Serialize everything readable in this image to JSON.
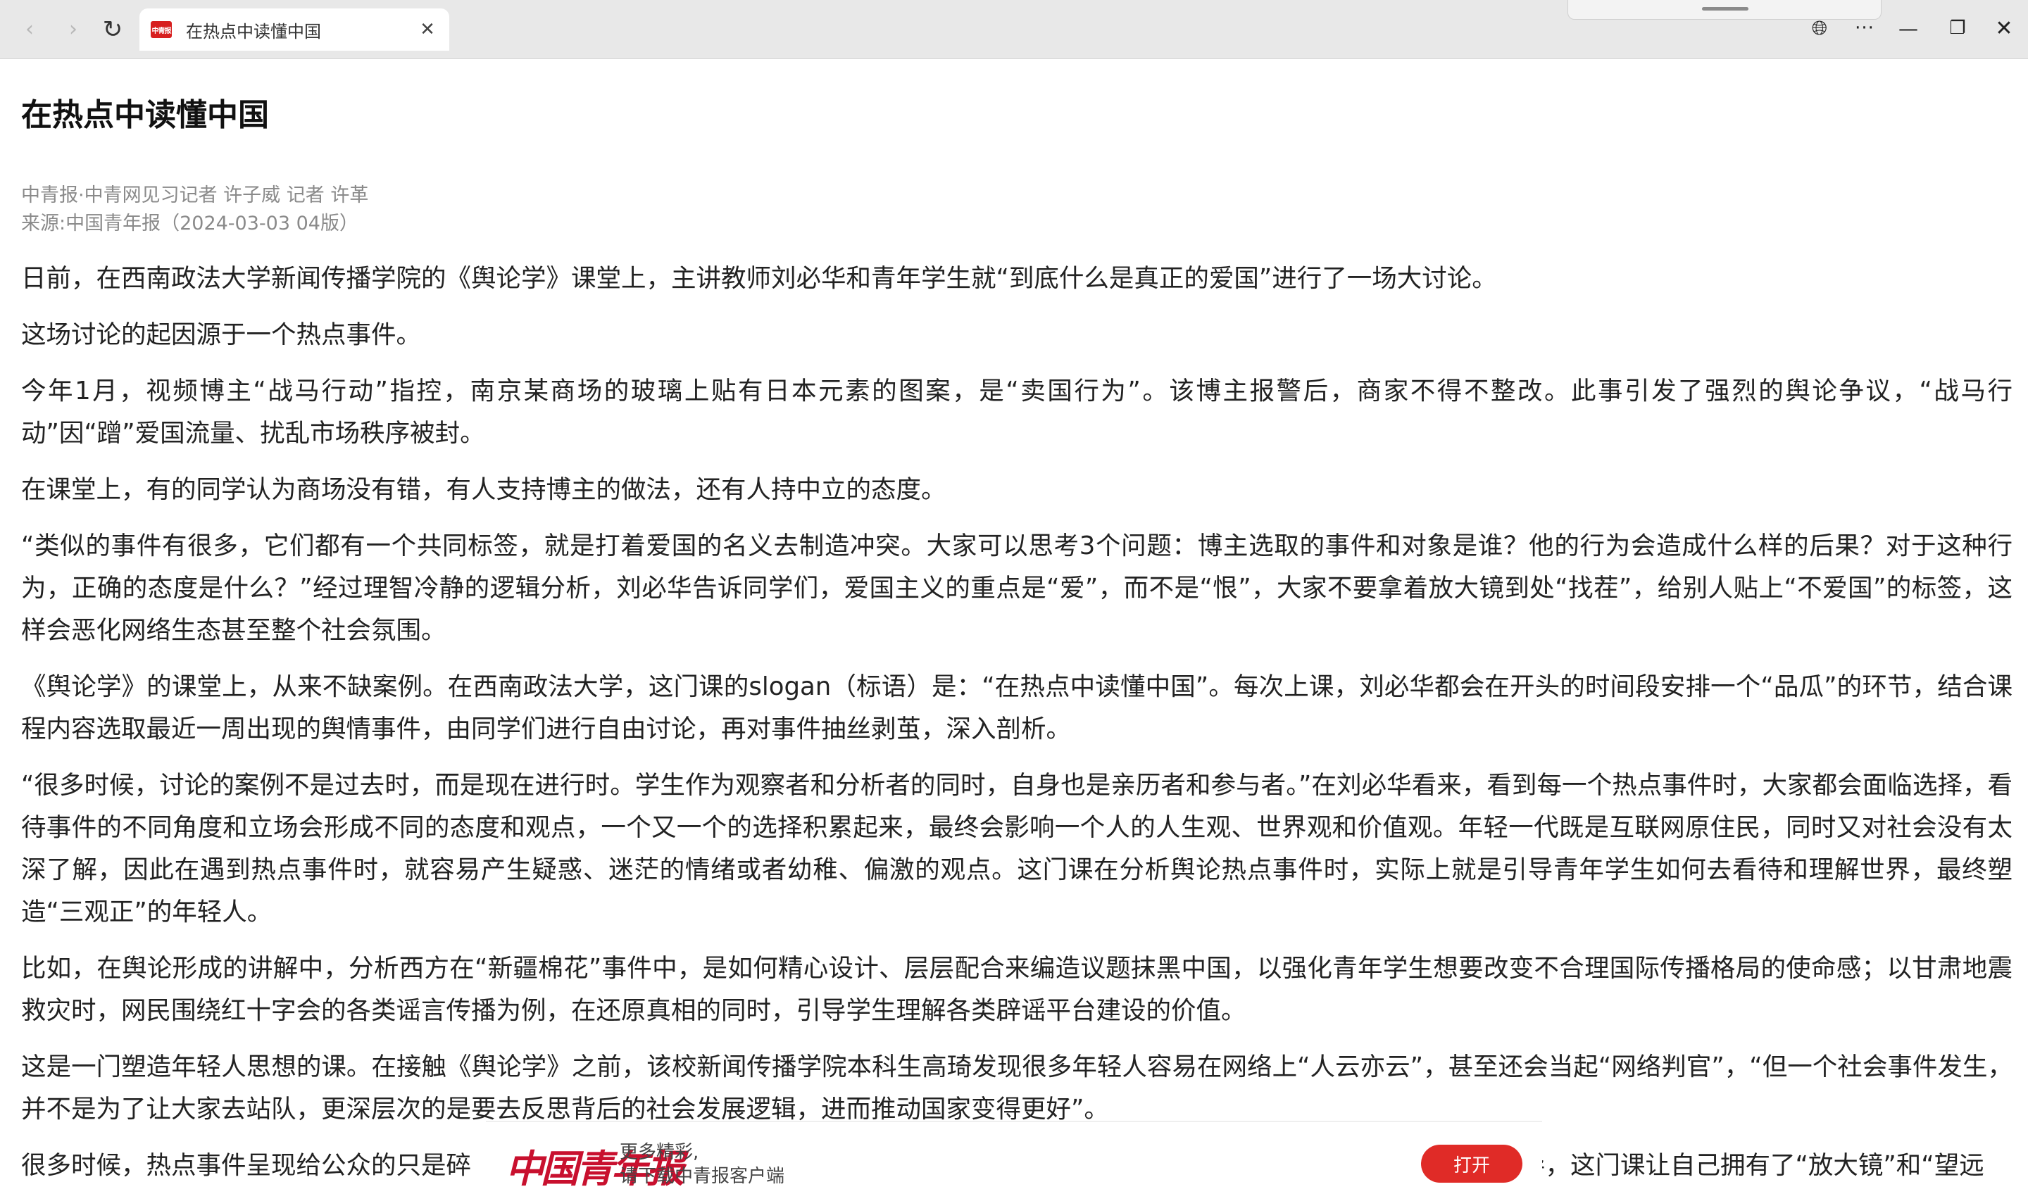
{
  "browser": {
    "tab_title": "在热点中读懂中国",
    "favicon_text": "中青报",
    "icons": {
      "back": "chevron-left-icon",
      "forward": "chevron-right-icon",
      "reload": "reload-icon",
      "tab_close": "close-icon",
      "translate": "globe-icon",
      "more": "more-horizontal-icon",
      "minimize": "minimize-icon",
      "maximize": "restore-icon",
      "close": "close-icon"
    }
  },
  "article": {
    "title": "在热点中读懂中国",
    "byline": "中青报·中青网见习记者 许子威 记者 许革",
    "source": "来源:中国青年报（2024-03-03 04版）",
    "paragraphs": [
      "日前，在西南政法大学新闻传播学院的《舆论学》课堂上，主讲教师刘必华和青年学生就“到底什么是真正的爱国”进行了一场大讨论。",
      "这场讨论的起因源于一个热点事件。",
      "今年1月，视频博主“战马行动”指控，南京某商场的玻璃上贴有日本元素的图案，是“卖国行为”。该博主报警后，商家不得不整改。此事引发了强烈的舆论争议，“战马行动”因“蹭”爱国流量、扰乱市场秩序被封。",
      "在课堂上，有的同学认为商场没有错，有人支持博主的做法，还有人持中立的态度。",
      "“类似的事件有很多，它们都有一个共同标签，就是打着爱国的名义去制造冲突。大家可以思考3个问题：博主选取的事件和对象是谁？他的行为会造成什么样的后果？对于这种行为，正确的态度是什么？”经过理智冷静的逻辑分析，刘必华告诉同学们，爱国主义的重点是“爱”，而不是“恨”，大家不要拿着放大镜到处“找茬”，给别人贴上“不爱国”的标签，这样会恶化网络生态甚至整个社会氛围。",
      "《舆论学》的课堂上，从来不缺案例。在西南政法大学，这门课的slogan（标语）是：“在热点中读懂中国”。每次上课，刘必华都会在开头的时间段安排一个“品瓜”的环节，结合课程内容选取最近一周出现的舆情事件，由同学们进行自由讨论，再对事件抽丝剥茧，深入剖析。",
      "“很多时候，讨论的案例不是过去时，而是现在进行时。学生作为观察者和分析者的同时，自身也是亲历者和参与者。”在刘必华看来，看到每一个热点事件时，大家都会面临选择，看待事件的不同角度和立场会形成不同的态度和观点，一个又一个的选择积累起来，最终会影响一个人的人生观、世界观和价值观。年轻一代既是互联网原住民，同时又对社会没有太深了解，因此在遇到热点事件时，就容易产生疑惑、迷茫的情绪或者幼稚、偏激的观点。这门课在分析舆论热点事件时，实际上就是引导青年学生如何去看待和理解世界，最终塑造“三观正”的年轻人。",
      "比如，在舆论形成的讲解中，分析西方在“新疆棉花”事件中，是如何精心设计、层层配合来编造议题抹黑中国，以强化青年学生想要改变不合理国际传播格局的使命感；以甘肃地震救灾时，网民围绕红十字会的各类谣言传播为例，在还原真相的同时，引导学生理解各类辟谣平台建设的价值。",
      "这是一门塑造年轻人思想的课。在接触《舆论学》之前，该校新闻传播学院本科生高琦发现很多年轻人容易在网络上“人云亦云”，甚至还会当起“网络判官”，“但一个社会事件发生，并不是为了让大家去站队，更深层次的是要去反思背后的社会发展逻辑，进而推动国家变得更好”。"
    ],
    "partial_paragraph_left": "很多时候，热点事件呈现给公众的只是碎",
    "partial_paragraph_right": "导，这门课让自己拥有了“放大镜”和“望远"
  },
  "app_banner": {
    "logo_text": "中国青年报",
    "line1": "更多精彩,",
    "line2": "请下载中青报客户端",
    "open_label": "打开"
  }
}
